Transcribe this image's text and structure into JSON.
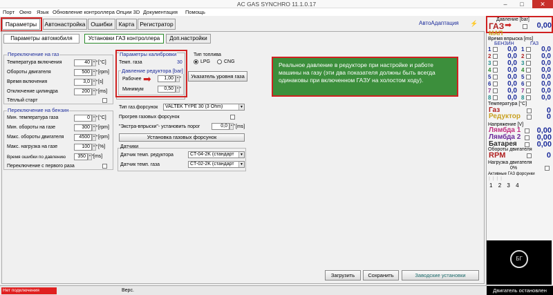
{
  "titlebar": {
    "title": "AC GAS SYNCHRO  11.1.0.17",
    "minimize": "–",
    "maximize": "□",
    "close": "✕"
  },
  "menu": [
    "Порт",
    "Окно",
    "Язык",
    "Обновление контроллера",
    "Опции 3D",
    "Документация",
    "Помощь"
  ],
  "tabs": {
    "parametry": "Параметры",
    "avtonastroyka": "Автонастройка",
    "oshibki": "Ошибки",
    "karta": "Карта",
    "registrator": "Регистратор"
  },
  "autoadapt": "АвтоАдаптация",
  "subtabs": {
    "auto": "Параметры автомобиля",
    "gas": "Установки ГАЗ контроллера",
    "extra": "Доп.настройки"
  },
  "switch_gas": {
    "title": "Переключение на газ",
    "rows": [
      {
        "label": "Температура включения",
        "value": "40",
        "unit": "[°C]"
      },
      {
        "label": "Обороты двигателя",
        "value": "500",
        "unit": "[rpm]"
      },
      {
        "label": "Время включения",
        "value": "3,0",
        "unit": "[s]"
      },
      {
        "label": "Отключение цилиндра",
        "value": "200",
        "unit": "[ms]"
      }
    ],
    "warm_start": "Тёплый старт"
  },
  "switch_petrol": {
    "title": "Переключение на бензин",
    "rows": [
      {
        "label": "Мин. температура газа",
        "value": "0",
        "unit": "[°C]"
      },
      {
        "label": "Мин. обороты на газе",
        "value": "300",
        "unit": "[rpm]"
      },
      {
        "label": "Макс. обороты двигателя",
        "value": "4500",
        "unit": "[rpm]"
      },
      {
        "label": "Макс. нагрузка на газе",
        "value": "100",
        "unit": "[%]"
      }
    ],
    "error_time_label": "Время ошибки по давлению",
    "error_time_value": "350",
    "error_time_unit": "[ms]",
    "first_switch": "Переключение с первого раза"
  },
  "calib": {
    "title": "Параметры калибровки",
    "gas_temp_label": "Темп. газа",
    "gas_temp_value": "30",
    "reducer_title": "Давление редуктора [bar]",
    "working_label": "Рабочее",
    "working_value": "1,00",
    "min_label": "Минимум",
    "min_value": "0,50"
  },
  "fuel": {
    "title": "Тип топлива",
    "lpg": "LPG",
    "cng": "CNG"
  },
  "level_button": "Указатель уровня газа",
  "injectors": {
    "type_label": "Тип газ.форсунок",
    "type_value": "VALTEK TYPE 30 (3 Ohm)",
    "heat_label": "Прогрев газовых форсунок",
    "extra_label": "\"Экстра-впрыски\"- установить порог",
    "extra_value": "0,0",
    "extra_unit": "[ms]",
    "install_button": "Установка газовых форсунок"
  },
  "sensors": {
    "title": "Датчики",
    "reducer_label": "Датчик темп. редуктора",
    "reducer_value": "CT-04-2K (стандарт",
    "gas_label": "Датчик темп. газа",
    "gas_value": "CT-02-2K (стандарт"
  },
  "callout_text": "Реальное давление в редукторе при настройке и работе машины на газу (эти два показателя должны быть всегда одинаковы при включенном ГАЗУ на холостом ходу).",
  "bottom_buttons": {
    "load": "Загрузить",
    "save": "Сохранить",
    "factory": "Заводские установки"
  },
  "right_panel": {
    "pressure_title": "Давление [bar]",
    "gaz_label": "ГАЗ",
    "gaz_value": "0,00",
    "map_label": "МАП",
    "injection_title": "Время впрыска [ms]",
    "petrol_label": "БЕНЗИН",
    "gas_label": "ГАЗ",
    "cylinders": [
      {
        "n": "1",
        "petrol": "0,0",
        "gas": "0,0",
        "color": "#1a2a9a"
      },
      {
        "n": "2",
        "petrol": "0,0",
        "gas": "0,0",
        "color": "#b02020"
      },
      {
        "n": "3",
        "petrol": "0,0",
        "gas": "0,0",
        "color": "#1a8a8a"
      },
      {
        "n": "4",
        "petrol": "0,0",
        "gas": "0,0",
        "color": "#2a8a2a"
      },
      {
        "n": "5",
        "petrol": "0,0",
        "gas": "0,0",
        "color": "#1a2a9a"
      },
      {
        "n": "6",
        "petrol": "0,0",
        "gas": "0,0",
        "color": "#1a2a9a"
      },
      {
        "n": "7",
        "petrol": "0,0",
        "gas": "0,0",
        "color": "#8a2a8a"
      },
      {
        "n": "8",
        "petrol": "0,0",
        "gas": "0,0",
        "color": "#1a8a8a"
      }
    ],
    "temp_title": "Температура [°C]",
    "gas_temp_label": "Газ",
    "gas_temp_value": "0",
    "reducer_label": "Редуктор",
    "reducer_value": "0",
    "voltage_title": "Напряжение [V]",
    "lambda1_label": "Лямбда 1",
    "lambda1_value": "0,00",
    "lambda2_label": "Лямбда 2",
    "lambda2_value": "0,00",
    "battery_label": "Батарея",
    "battery_value": "0,00",
    "rpm_title": "Обороты двигателя",
    "rpm_label": "RPM",
    "rpm_value": "0",
    "load_title": "Нагрузка двигателя",
    "load_value": "0%",
    "active_title": "Активные ГАЗ форсунки",
    "active_nums": [
      "1",
      "2",
      "3",
      "4"
    ],
    "logo_text": "БГ"
  },
  "status": {
    "connection": "Нет подключения",
    "version": "Верс.",
    "engine": "Двигатель остановлен"
  },
  "colors": {
    "callout": "#3c8f3c",
    "highlight": "#d02020",
    "blue_text": "#1a2a9a"
  }
}
